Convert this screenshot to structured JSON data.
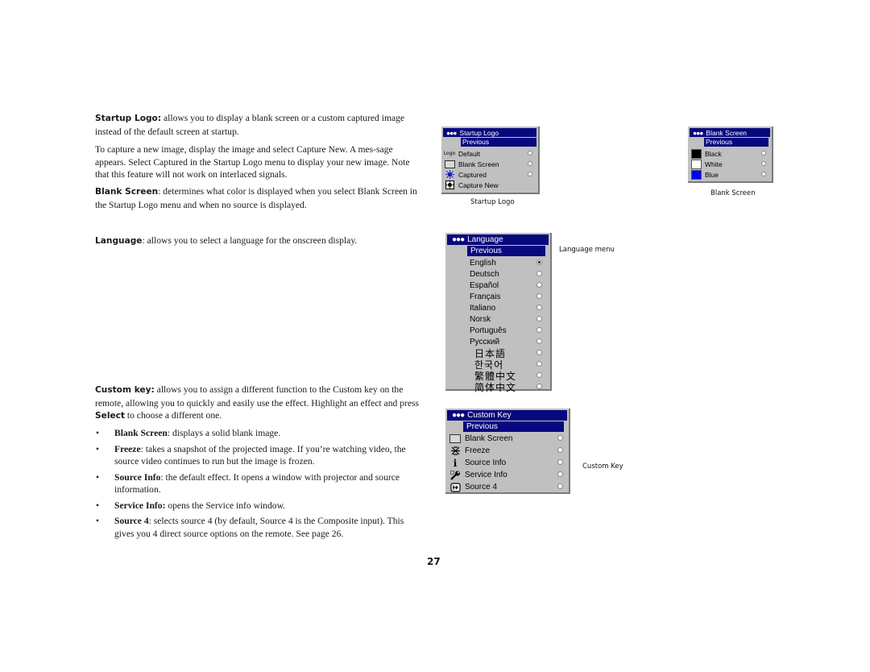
{
  "page_number": "27",
  "text": {
    "startup_logo": {
      "term": "Startup Logo:",
      "body": " allows you to display a blank screen or a custom captured image instead of the default screen at startup."
    },
    "capture_para": "To capture a new image, display the image and select Capture New. A mes-sage appears. Select Captured in the Startup Logo menu to display your new image. Note that this feature will not work on interlaced signals.",
    "blank_screen": {
      "term": "Blank Screen",
      "body": ": determines what color is displayed when you select Blank Screen in the Startup Logo menu and when no source is displayed."
    },
    "language": {
      "term": "Language",
      "body": ": allows you to select a language for the onscreen display."
    },
    "custom_key": {
      "term": "Custom key:",
      "body1": " allows you to assign a different function to the Custom key on the remote, allowing you to quickly and easily use the effect. Highlight an effect and press ",
      "select": "Select",
      "body2": " to choose a different one."
    },
    "bullet_glyph": "•",
    "bullets": [
      {
        "term": "Blank Screen",
        "body": ": displays a solid blank image."
      },
      {
        "term": "Freeze",
        "body": ": takes a snapshot of the projected image. If you’re watching video, the source video continues to run but the image is frozen."
      },
      {
        "term": "Source Info",
        "body": ": the default effect. It opens a window with projector and source information."
      },
      {
        "term": "Service Info:",
        "body": " opens the Service info window."
      },
      {
        "term": "Source 4",
        "body": ": selects source 4 (by default, Source 4 is the Composite input). This gives you 4 direct source options on the remote. See page 26."
      }
    ]
  },
  "menus": {
    "startup_logo": {
      "title_dots": "●●●",
      "title": "Startup Logo",
      "previous": "Previous",
      "items": [
        {
          "label": "Default",
          "icon": "logo-icon",
          "radio": true,
          "selected": false
        },
        {
          "label": "Blank Screen",
          "icon": "blank-screen-icon",
          "radio": true,
          "selected": false
        },
        {
          "label": "Captured",
          "icon": "captured-icon",
          "radio": true,
          "selected": false
        },
        {
          "label": "Capture New",
          "icon": "capture-new-icon",
          "radio": false,
          "selected": false
        }
      ],
      "caption": "Startup Logo",
      "logo_glyph": "Logo"
    },
    "blank_screen": {
      "title_dots": "●●●",
      "title": "Blank Screen",
      "previous": "Previous",
      "items": [
        {
          "label": "Black",
          "swatch": "#000000",
          "selected": false
        },
        {
          "label": "White",
          "swatch": "#ffffff",
          "selected": false
        },
        {
          "label": "Blue",
          "swatch": "#0000ff",
          "selected": false
        }
      ],
      "caption": "Blank Screen"
    },
    "language": {
      "title_dots": "●●●",
      "title": "Language",
      "previous": "Previous",
      "items": [
        {
          "label": "English",
          "selected": true
        },
        {
          "label": "Deutsch",
          "selected": false
        },
        {
          "label": "Español",
          "selected": false
        },
        {
          "label": "Français",
          "selected": false
        },
        {
          "label": "Italiano",
          "selected": false
        },
        {
          "label": "Norsk",
          "selected": false
        },
        {
          "label": "Português",
          "selected": false
        },
        {
          "label": "Русский",
          "selected": false
        },
        {
          "label": "日本語",
          "selected": false
        },
        {
          "label": "한국어",
          "selected": false
        },
        {
          "label": "繁體中文",
          "selected": false
        },
        {
          "label": "简体中文",
          "selected": false
        }
      ],
      "caption": "Language menu"
    },
    "custom_key": {
      "title_dots": "●●●",
      "title": "Custom Key",
      "previous": "Previous",
      "items": [
        {
          "label": "Blank Screen",
          "icon": "blank-screen-icon",
          "selected": false
        },
        {
          "label": "Freeze",
          "icon": "freeze-icon",
          "selected": false
        },
        {
          "label": "Source Info",
          "icon": "info-icon",
          "selected": false
        },
        {
          "label": "Service Info",
          "icon": "wrench-icon",
          "selected": false
        },
        {
          "label": "Source 4",
          "icon": "source-icon",
          "selected": false
        }
      ],
      "caption": "Custom Key",
      "info_glyph": "i"
    }
  },
  "colors": {
    "menu_title_bg": "#08087e",
    "menu_bg": "#c0c0c0"
  }
}
